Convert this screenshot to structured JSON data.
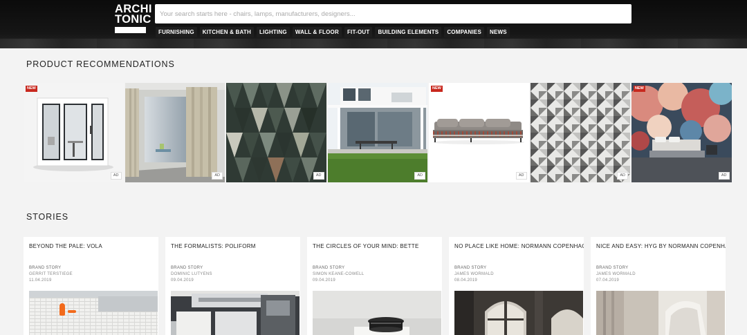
{
  "header": {
    "logo_line1": "ARCHI",
    "logo_line2": "TONIC",
    "search_placeholder": "Your search starts here - chairs, lamps, manufacturers, designers...",
    "nav": [
      "FURNISHING",
      "KITCHEN & BATH",
      "LIGHTING",
      "WALL & FLOOR",
      "FIT-OUT",
      "BUILDING ELEMENTS",
      "COMPANIES",
      "NEWS"
    ]
  },
  "products": {
    "title": "PRODUCT RECOMMENDATIONS",
    "new_label": "NEW",
    "ad_label": "AD",
    "items": [
      {
        "new": true,
        "ad": true,
        "subject": "office phone booth"
      },
      {
        "new": false,
        "ad": true,
        "subject": "curtain room"
      },
      {
        "new": false,
        "ad": true,
        "subject": "triangle stone tiles"
      },
      {
        "new": false,
        "ad": true,
        "subject": "modern house terrace"
      },
      {
        "new": true,
        "ad": true,
        "subject": "sofa"
      },
      {
        "new": false,
        "ad": true,
        "subject": "geometric tiles"
      },
      {
        "new": true,
        "ad": true,
        "subject": "floral wallpaper bedroom"
      }
    ]
  },
  "stories": {
    "title": "STORIES",
    "items": [
      {
        "title": "BEYOND THE PALE: VOLA",
        "type": "BRAND STORY",
        "author": "GERRIT TERSTIEGE",
        "date": "11.04.2019"
      },
      {
        "title": "THE FORMALISTS: POLIFORM",
        "type": "BRAND STORY",
        "author": "DOMINIC LUTYENS",
        "date": "09.04.2019"
      },
      {
        "title": "THE CIRCLES OF YOUR MIND: BETTE",
        "type": "BRAND STORY",
        "author": "SIMON KEANE-COWELL",
        "date": "09.04.2019"
      },
      {
        "title": "NO PLACE LIKE HOME: NORMANN COPENHAGEN",
        "type": "BRAND STORY",
        "author": "JAMES WORMALD",
        "date": "08.04.2019"
      },
      {
        "title": "NICE AND EASY: HYG BY NORMANN COPENHAGEN",
        "type": "BRAND STORY",
        "author": "JAMES WORMALD",
        "date": "07.04.2019"
      }
    ]
  }
}
